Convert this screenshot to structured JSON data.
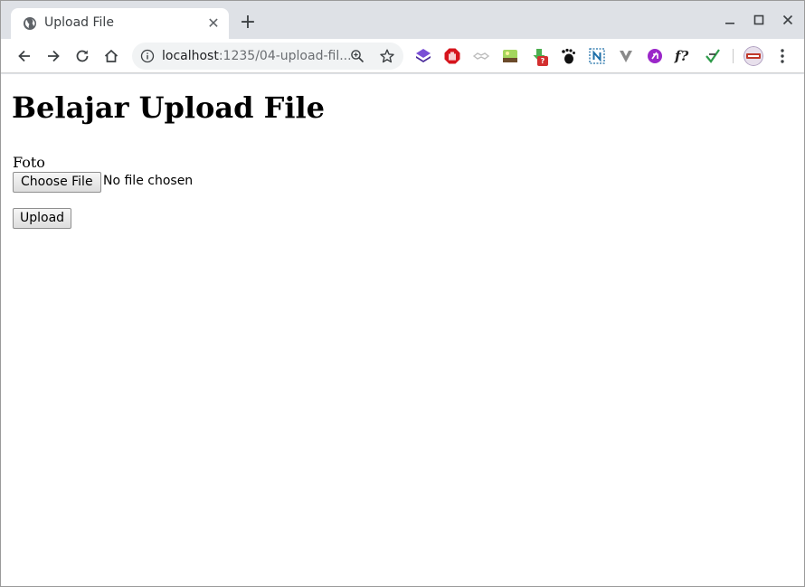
{
  "tab": {
    "title": "Upload File",
    "favicon": "globe-icon"
  },
  "window_controls": [
    "minimize-icon",
    "maximize-icon",
    "close-icon"
  ],
  "address_bar": {
    "host": "localhost",
    "rest": ":1235/04-upload-fil..."
  },
  "extensions": [
    {
      "name": "purple-layers-extension-icon",
      "color": "#5b2fb0"
    },
    {
      "name": "red-stop-hand-extension-icon",
      "color": "#d6141c"
    },
    {
      "name": "grey-handshake-extension-icon",
      "color": "#bdbdbd"
    },
    {
      "name": "green-landscape-extension-icon",
      "color": "#6fb23a"
    },
    {
      "name": "green-download-extension-icon",
      "color": "#4caf50",
      "badge": "?"
    },
    {
      "name": "gnome-foot-extension-icon",
      "color": "#111111"
    },
    {
      "name": "n-box-extension-icon",
      "color": "#1e6fa8"
    },
    {
      "name": "grey-v-extension-icon",
      "color": "#8a8a8a"
    },
    {
      "name": "purple-circle-extension-icon",
      "color": "#9b27c9"
    },
    {
      "name": "f-question-extension-icon",
      "text": "f?"
    },
    {
      "name": "green-check-extension-icon",
      "color": "#2e9b4a"
    }
  ],
  "page": {
    "heading": "Belajar Upload File",
    "field_label": "Foto",
    "file_button": "Choose File",
    "file_status": "No file chosen",
    "submit_button": "Upload"
  }
}
